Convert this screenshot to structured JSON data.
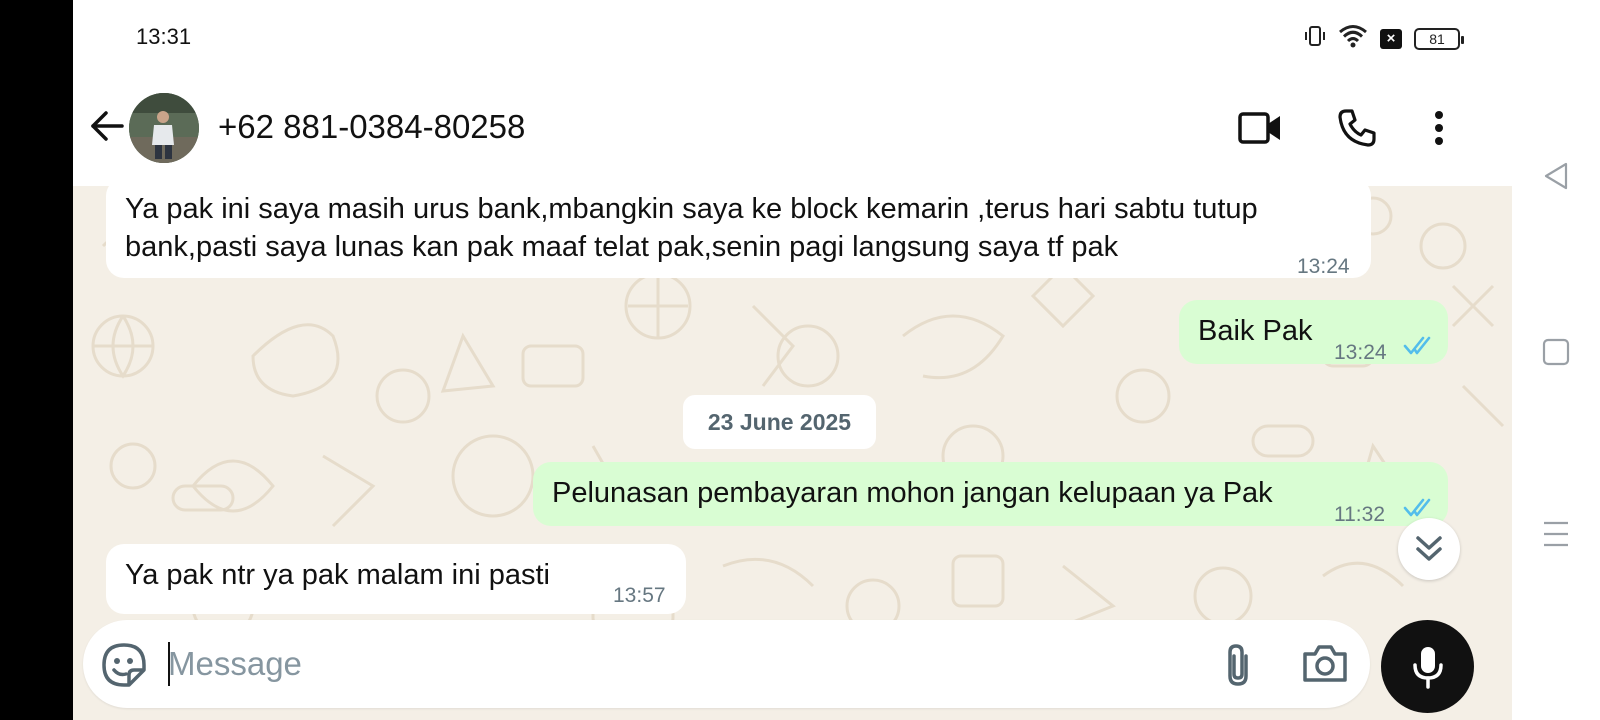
{
  "status_bar": {
    "time": "13:31",
    "battery": "81",
    "icons": [
      "vibrate-icon",
      "wifi-icon",
      "no-sim-icon",
      "battery-icon"
    ]
  },
  "header": {
    "contact": "+62 881-0384-80258",
    "actions": [
      "back-arrow-icon",
      "video-call-icon",
      "voice-call-icon",
      "more-options-icon"
    ]
  },
  "messages": [
    {
      "direction": "incoming",
      "lines": [
        "Ya pak ini saya masih urus bank,mbangkin saya ke block kemarin ,terus hari sabtu tutup",
        "bank,pasti saya lunas kan pak maaf telat pak,senin pagi langsung saya tf pak"
      ],
      "time": "13:24"
    },
    {
      "direction": "outgoing",
      "text": "Baik Pak",
      "time": "13:24",
      "status": "read"
    },
    {
      "direction": "outgoing",
      "text": "Pelunasan pembayaran mohon jangan kelupaan ya Pak",
      "time": "11:32",
      "status": "read"
    },
    {
      "direction": "incoming",
      "text": "Ya pak ntr ya pak malam ini pasti",
      "time": "13:57"
    }
  ],
  "date_separator": "23 June 2025",
  "composer": {
    "placeholder": "Message",
    "value": ""
  },
  "colors": {
    "chat_background": "#f4efe6",
    "incoming_bubble": "#ffffff",
    "outgoing_bubble": "#d9fdd3",
    "read_tick": "#53bdeb",
    "timestamp": "#667781",
    "mic_button": "#111111"
  },
  "nav_bar": {
    "buttons": [
      "nav-back-icon",
      "nav-home-icon",
      "nav-recents-icon"
    ]
  }
}
